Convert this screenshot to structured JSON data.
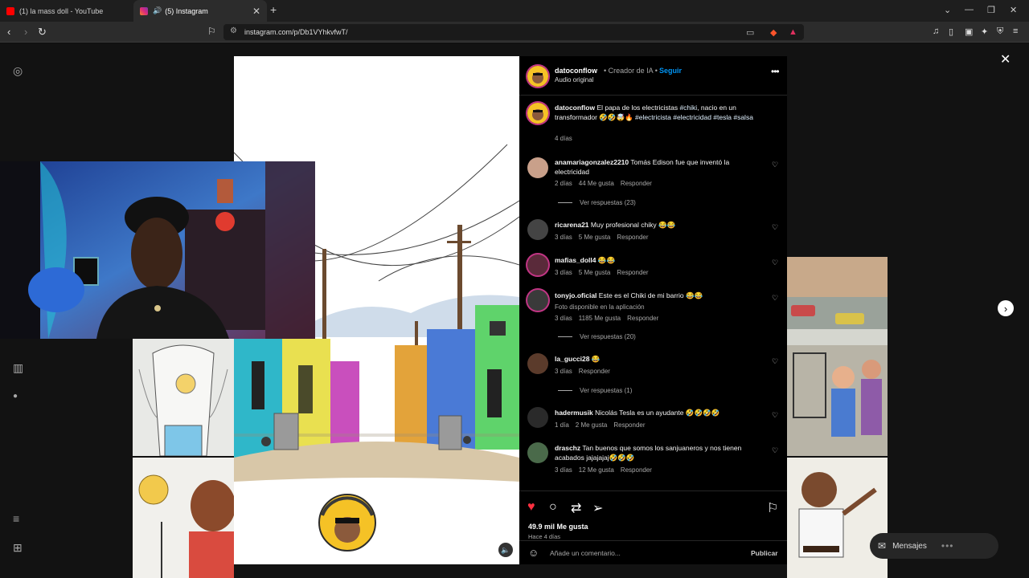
{
  "browser": {
    "tabs": [
      {
        "label": "(1) la mass doll - YouTube",
        "favicon_color": "#ff0000",
        "active": false
      },
      {
        "label": "(5) Instagram",
        "favicon_color": "#e1306c",
        "active": true
      }
    ],
    "url": "instagram.com/p/Db1VYhkvfwT/"
  },
  "post": {
    "username": "datoconflow",
    "separator": " • ",
    "creator_tag": "Creador de IA",
    "follow_label": "Seguir",
    "audio": "Audio original",
    "caption_text": "El papa de los electricistas",
    "caption_tag1": "#chiki",
    "caption_cont": ", nacio en un transformador 🤣🤣🤯🔥",
    "caption_tags2": "#electricista #electricidad #tesla #salsa",
    "caption_age": "4 días"
  },
  "comments": [
    {
      "user": "anamariagonzalez2210",
      "text": "Tomás Edison fue que inventó la electricidad",
      "age": "2 días",
      "likes": "44 Me gusta",
      "reply": "Responder",
      "replies": "Ver respuestas (23)"
    },
    {
      "user": "ricarena21",
      "text": "Muy profesional chiky 😂😂",
      "age": "3 días",
      "likes": "5 Me gusta",
      "reply": "Responder"
    },
    {
      "user": "mafias_doll4",
      "text": "😂😂",
      "age": "3 días",
      "likes": "5 Me gusta",
      "reply": "Responder"
    },
    {
      "user": "tonyjo.oficial",
      "text": "Este es el Chiki de mi barrio 😂😂",
      "extra": "Foto disponible en la aplicación",
      "age": "3 días",
      "likes": "1185 Me gusta",
      "reply": "Responder",
      "replies": "Ver respuestas (20)"
    },
    {
      "user": "la_gucci28",
      "text": "😂",
      "age": "3 días",
      "reply": "Responder",
      "replies": "Ver respuestas (1)"
    },
    {
      "user": "hadermusik",
      "text": "Nicolás Tesla es un ayudante 🤣🤣🤣🤣",
      "age": "1 día",
      "likes": "2 Me gusta",
      "reply": "Responder"
    },
    {
      "user": "draschz",
      "text": "Tan buenos que somos los sanjuaneros y nos tienen acabados jajajajaj🤣🤣🤣",
      "age": "3 días",
      "likes": "12 Me gusta",
      "reply": "Responder"
    }
  ],
  "footer": {
    "likes": "49.9 mil Me gusta",
    "ago": "Hace 4 días",
    "comment_placeholder": "Añade un comentario...",
    "publish": "Publicar"
  },
  "messages_label": "Mensajes",
  "reel_badge": "datoconflow",
  "colors": {
    "accent": "#0095f6",
    "like": "#ff3040",
    "panel": "#000000"
  },
  "icons": [
    "instagram-icon",
    "heart-icon",
    "comment-icon",
    "repost-icon",
    "share-icon",
    "bookmark-icon",
    "emoji-icon",
    "close-icon",
    "chevron-right-icon",
    "more-icon",
    "mute-icon"
  ]
}
